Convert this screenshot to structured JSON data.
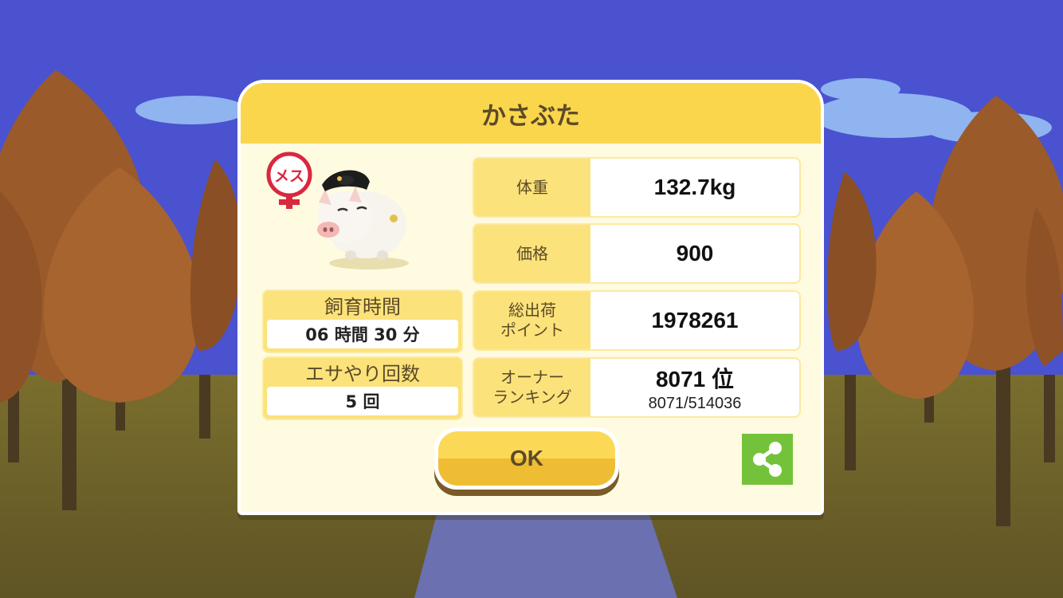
{
  "dialog": {
    "title": "かさぶた",
    "gender_badge": "メス",
    "rearing_time": {
      "label": "飼育時間",
      "value": "06 時間 30 分"
    },
    "feed_count": {
      "label": "エサやり回数",
      "value": "5 回"
    },
    "stats": [
      {
        "label": "体重",
        "value": "132.7kg"
      },
      {
        "label": "価格",
        "value": "900"
      },
      {
        "label": "総出荷\nポイント",
        "value": "1978261"
      },
      {
        "label": "オーナー\nランキング",
        "value": "8071 位",
        "sub": "8071/514036"
      }
    ],
    "ok_label": "OK",
    "share_icon": "share-icon"
  },
  "colors": {
    "sky": "#4a52d0",
    "title_bar": "#fad64c",
    "panel": "#fffbe0",
    "label_box": "#fbe27a",
    "share_button": "#74c23a",
    "gender_badge": "#d9273f"
  }
}
